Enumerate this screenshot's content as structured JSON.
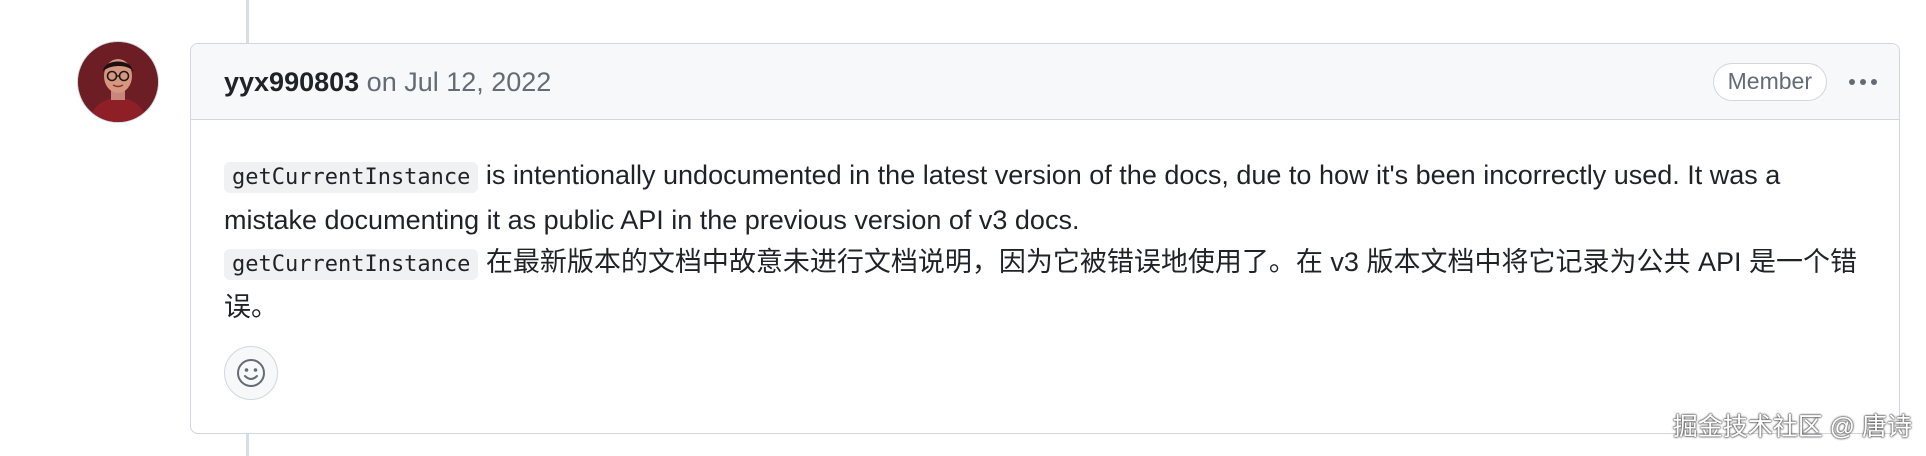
{
  "comment": {
    "author": "yyx990803",
    "date_text": "on Jul 12, 2022",
    "role_badge": "Member",
    "body": {
      "en_code": "getCurrentInstance",
      "en_text": " is intentionally undocumented in the latest version of the docs, due to how it's been incorrectly used. It was a mistake documenting it as public API in the previous version of v3 docs.",
      "zh_code": "getCurrentInstance",
      "zh_text": " 在最新版本的文档中故意未进行文档说明，因为它被错误地使用了。在 v3 版本文档中将它记录为公共 API 是一个错误。"
    }
  },
  "icons": {
    "avatar": "avatar",
    "more": "kebab-horizontal-icon",
    "reaction": "smiley-icon"
  },
  "watermark": "掘金技术社区 @ 唐诗",
  "colors": {
    "border": "#d0d7de",
    "header_bg": "#f6f8fa",
    "muted_text": "#636c76",
    "code_bg": "#eff1f3"
  }
}
